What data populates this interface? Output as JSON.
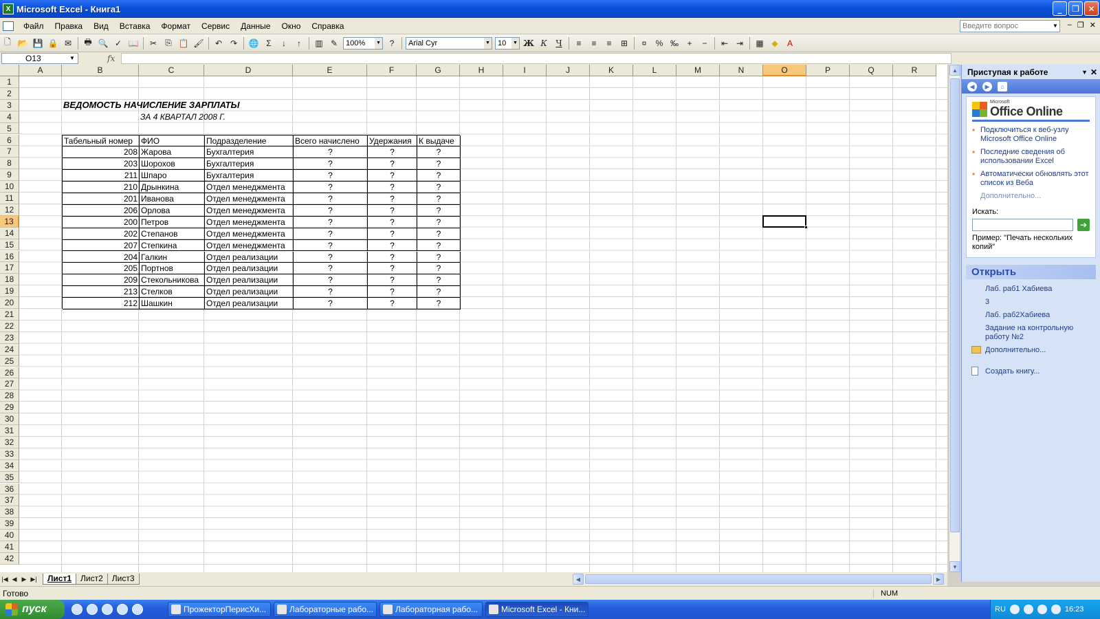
{
  "window": {
    "title": "Microsoft Excel - Книга1",
    "app_icon": "excel-icon"
  },
  "menu": {
    "items": [
      "Файл",
      "Правка",
      "Вид",
      "Вставка",
      "Формат",
      "Сервис",
      "Данные",
      "Окно",
      "Справка"
    ],
    "ask_placeholder": "Введите вопрос"
  },
  "toolbar": {
    "zoom": "100%",
    "font": "Arial Cyr",
    "size": "10",
    "bold": "Ж",
    "italic": "К",
    "underline": "Ч"
  },
  "formula_bar": {
    "name_box": "O13",
    "fx": "fx",
    "content": ""
  },
  "columns": [
    "A",
    "B",
    "C",
    "D",
    "E",
    "F",
    "G",
    "H",
    "I",
    "J",
    "K",
    "L",
    "M",
    "N",
    "O",
    "P",
    "Q",
    "R"
  ],
  "selected_column": "O",
  "selected_row": 13,
  "rows": [
    1,
    2,
    3,
    4,
    5,
    6,
    7,
    8,
    9,
    10,
    11,
    12,
    13,
    14,
    15,
    16,
    17,
    18,
    19,
    20,
    21,
    22,
    23,
    24,
    25,
    26,
    27,
    28,
    29,
    30,
    31,
    32,
    33,
    34,
    35,
    36,
    37,
    38,
    39,
    40,
    41,
    42
  ],
  "sheet": {
    "title": "ВЕДОМОСТЬ НАЧИСЛЕНИЕ ЗАРПЛАТЫ",
    "subtitle": "ЗА 4 КВАРТАЛ 2008 Г.",
    "headers": [
      "Табельный номер",
      "ФИО",
      "Подразделение",
      "Всего начислено",
      "Удержания",
      "К выдаче"
    ],
    "records": [
      [
        "208",
        "Жарова",
        "Бухгалтерия",
        "?",
        "?",
        "?"
      ],
      [
        "203",
        "Шорохов",
        "Бухгалтерия",
        "?",
        "?",
        "?"
      ],
      [
        "211",
        "Шпаро",
        "Бухгалтерия",
        "?",
        "?",
        "?"
      ],
      [
        "210",
        "Дрынкина",
        "Отдел менеджмента",
        "?",
        "?",
        "?"
      ],
      [
        "201",
        "Иванова",
        "Отдел менеджмента",
        "?",
        "?",
        "?"
      ],
      [
        "206",
        "Орлова",
        "Отдел менеджмента",
        "?",
        "?",
        "?"
      ],
      [
        "200",
        "Петров",
        "Отдел менеджмента",
        "?",
        "?",
        "?"
      ],
      [
        "202",
        "Степанов",
        "Отдел менеджмента",
        "?",
        "?",
        "?"
      ],
      [
        "207",
        "Степкина",
        "Отдел менеджмента",
        "?",
        "?",
        "?"
      ],
      [
        "204",
        "Галкин",
        "Отдел реализации",
        "?",
        "?",
        "?"
      ],
      [
        "205",
        "Портнов",
        "Отдел реализации",
        "?",
        "?",
        "?"
      ],
      [
        "209",
        "Стекольникова",
        "Отдел реализации",
        "?",
        "?",
        "?"
      ],
      [
        "213",
        "Стелков",
        "Отдел реализации",
        "?",
        "?",
        "?"
      ],
      [
        "212",
        "Шашкин",
        "Отдел реализации",
        "?",
        "?",
        "?"
      ]
    ]
  },
  "sheet_tabs": [
    "Лист1",
    "Лист2",
    "Лист3"
  ],
  "active_tab": "Лист1",
  "taskpane": {
    "header": "Приступая к работе",
    "logo_small": "Microsoft",
    "logo_text": "Office Online",
    "links": [
      "Подключиться к веб-узлу Microsoft Office Online",
      "Последние сведения об использовании Excel",
      "Автоматически обновлять этот список из Веба"
    ],
    "more": "Дополнительно...",
    "search_label": "Искать:",
    "example": "Пример: \"Печать нескольких копий\"",
    "open_title": "Открыть",
    "open_items": [
      "Лаб. раб1 Хабиева",
      "3",
      "Лаб. раб2Хабиева",
      "Задание на контрольную работу №2"
    ],
    "open_more": "Дополнительно...",
    "create": "Создать книгу..."
  },
  "status": {
    "ready": "Готово",
    "num": "NUM"
  },
  "taskbar": {
    "start": "пуск",
    "tasks": [
      "ПрожекторПерисХи...",
      "Лабораторные рабо...",
      "Лабораторная рабо...",
      "Microsoft Excel - Кни..."
    ],
    "lang": "RU",
    "clock": "16:23"
  }
}
